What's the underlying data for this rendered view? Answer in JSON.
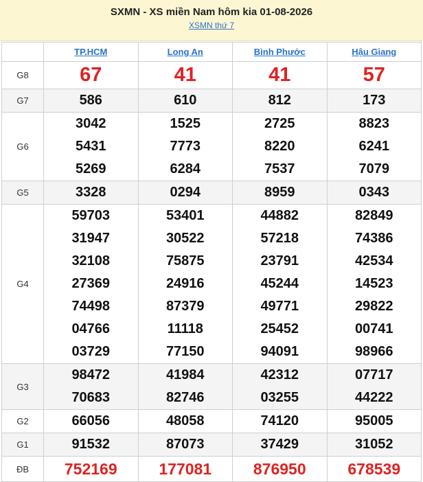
{
  "header": {
    "title": "SXMN - XS miền Nam hôm kia 01-08-2026",
    "subtitle": "XSMN thứ 7"
  },
  "provinces": [
    "TP.HCM",
    "Long An",
    "Bình Phước",
    "Hậu Giang"
  ],
  "prizes": [
    {
      "label": "G8",
      "values": [
        [
          "67"
        ],
        [
          "41"
        ],
        [
          "41"
        ],
        [
          "57"
        ]
      ]
    },
    {
      "label": "G7",
      "values": [
        [
          "586"
        ],
        [
          "610"
        ],
        [
          "812"
        ],
        [
          "173"
        ]
      ]
    },
    {
      "label": "G6",
      "values": [
        [
          "3042",
          "5431",
          "5269"
        ],
        [
          "1525",
          "7773",
          "6284"
        ],
        [
          "2725",
          "8220",
          "7537"
        ],
        [
          "8823",
          "6241",
          "7079"
        ]
      ]
    },
    {
      "label": "G5",
      "values": [
        [
          "3328"
        ],
        [
          "0294"
        ],
        [
          "8959"
        ],
        [
          "0343"
        ]
      ]
    },
    {
      "label": "G4",
      "values": [
        [
          "59703",
          "31947",
          "32108",
          "27369",
          "74498",
          "04766",
          "03729"
        ],
        [
          "53401",
          "30522",
          "75875",
          "24916",
          "87379",
          "11118",
          "77150"
        ],
        [
          "44882",
          "57218",
          "23791",
          "45244",
          "49771",
          "25452",
          "94091"
        ],
        [
          "82849",
          "74386",
          "42534",
          "14523",
          "29822",
          "00741",
          "98966"
        ]
      ]
    },
    {
      "label": "G3",
      "values": [
        [
          "98472",
          "70683"
        ],
        [
          "41984",
          "82746"
        ],
        [
          "42312",
          "03255"
        ],
        [
          "07717",
          "44222"
        ]
      ]
    },
    {
      "label": "G2",
      "values": [
        [
          "66056"
        ],
        [
          "48058"
        ],
        [
          "74120"
        ],
        [
          "95005"
        ]
      ]
    },
    {
      "label": "G1",
      "values": [
        [
          "91532"
        ],
        [
          "87073"
        ],
        [
          "37429"
        ],
        [
          "31052"
        ]
      ]
    },
    {
      "label": "ĐB",
      "values": [
        [
          "752169"
        ],
        [
          "177081"
        ],
        [
          "876950"
        ],
        [
          "678539"
        ]
      ]
    }
  ]
}
